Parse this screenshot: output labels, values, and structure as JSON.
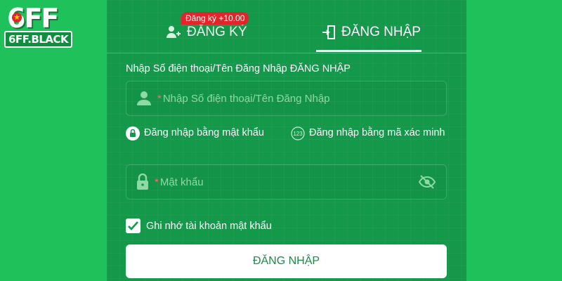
{
  "logo": {
    "top_text": "6FF",
    "bottom_text": "6FF.BLACK"
  },
  "tabs": {
    "register_label": "ĐĂNG KÝ",
    "login_label": "ĐĂNG NHẬP",
    "promo_badge": "Đăng ký +10.00",
    "active": "login"
  },
  "form": {
    "field_label": "Nhập Số điện thoại/Tên Đăng Nhập ĐĂNG NHẬP",
    "phone_placeholder": "Nhập Số điện thoại/Tên Đăng Nhập",
    "password_placeholder": "Mật khẩu",
    "required_mark": "*",
    "option_password": "Đăng nhập bằng mật khẩu",
    "option_code": "Đăng nhập bằng mã xác minh",
    "remember_label": "Ghi nhớ tài khoản mật khẩu",
    "remember_checked": true,
    "submit_label": "ĐĂNG NHẬP"
  },
  "icons": {
    "register": "add-user-icon",
    "login": "login-door-icon",
    "user": "user-icon",
    "lock": "lock-icon",
    "code": "code-123-icon",
    "eye": "eye-off-icon",
    "check": "check-icon"
  },
  "colors": {
    "background": "#1fc25a",
    "panel": "#14984a",
    "promo_badge": "#e0262b",
    "button_text": "#1a8b47"
  }
}
